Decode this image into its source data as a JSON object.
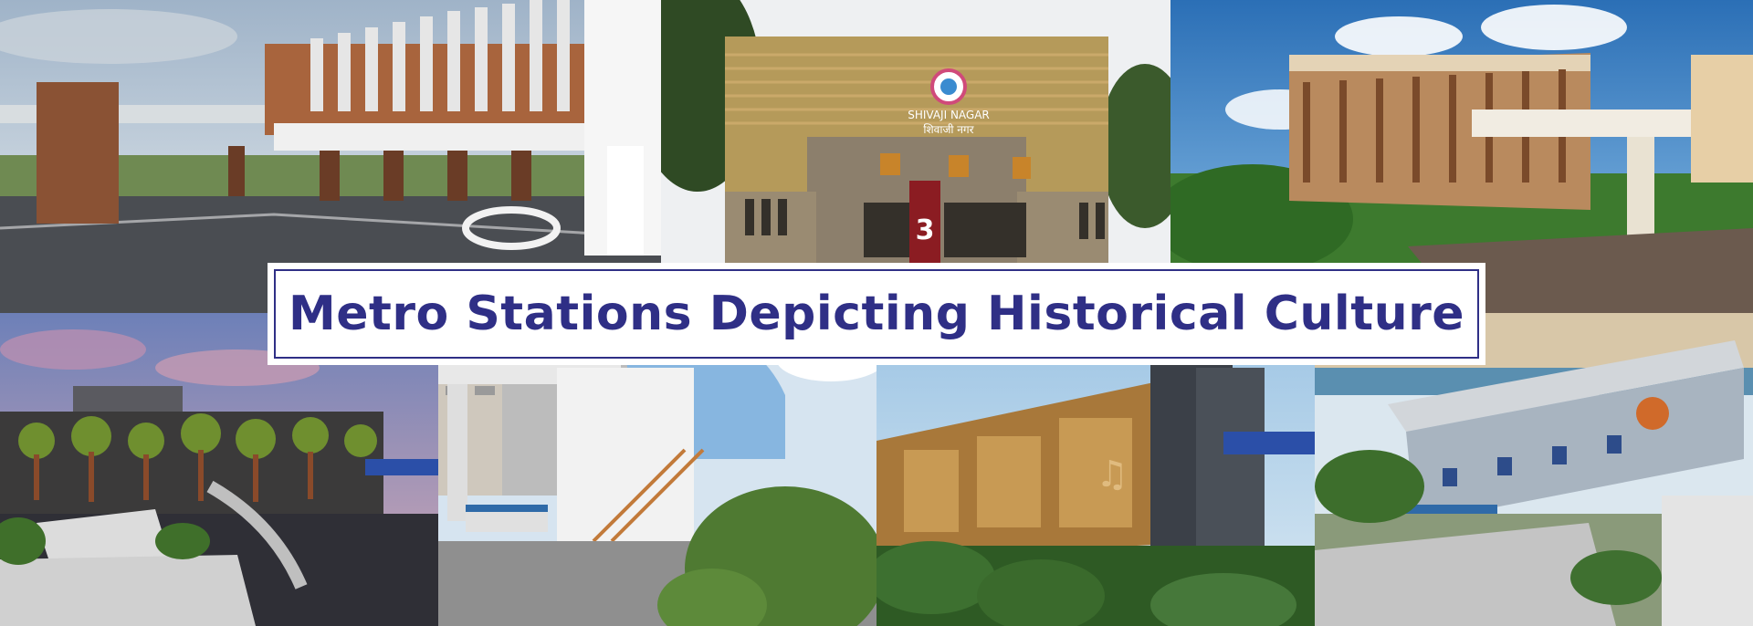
{
  "banner": {
    "title": "Metro Stations Depicting Historical Culture"
  },
  "photos": [
    {
      "name": "elevated-station-with-fins"
    },
    {
      "name": "shivaji-nagar-station",
      "sign_english": "SHIVAJI NAGAR",
      "sign_marathi": "शिवाजी नगर",
      "pillar_number": "3"
    },
    {
      "name": "arched-heritage-station"
    },
    {
      "name": "tree-mural-station"
    },
    {
      "name": "curved-roof-station"
    },
    {
      "name": "music-mural-station"
    },
    {
      "name": "curved-canopy-station"
    }
  ],
  "colors": {
    "banner_text": "#2f2f86",
    "banner_border": "#2f2f86",
    "banner_bg": "#ffffff"
  }
}
